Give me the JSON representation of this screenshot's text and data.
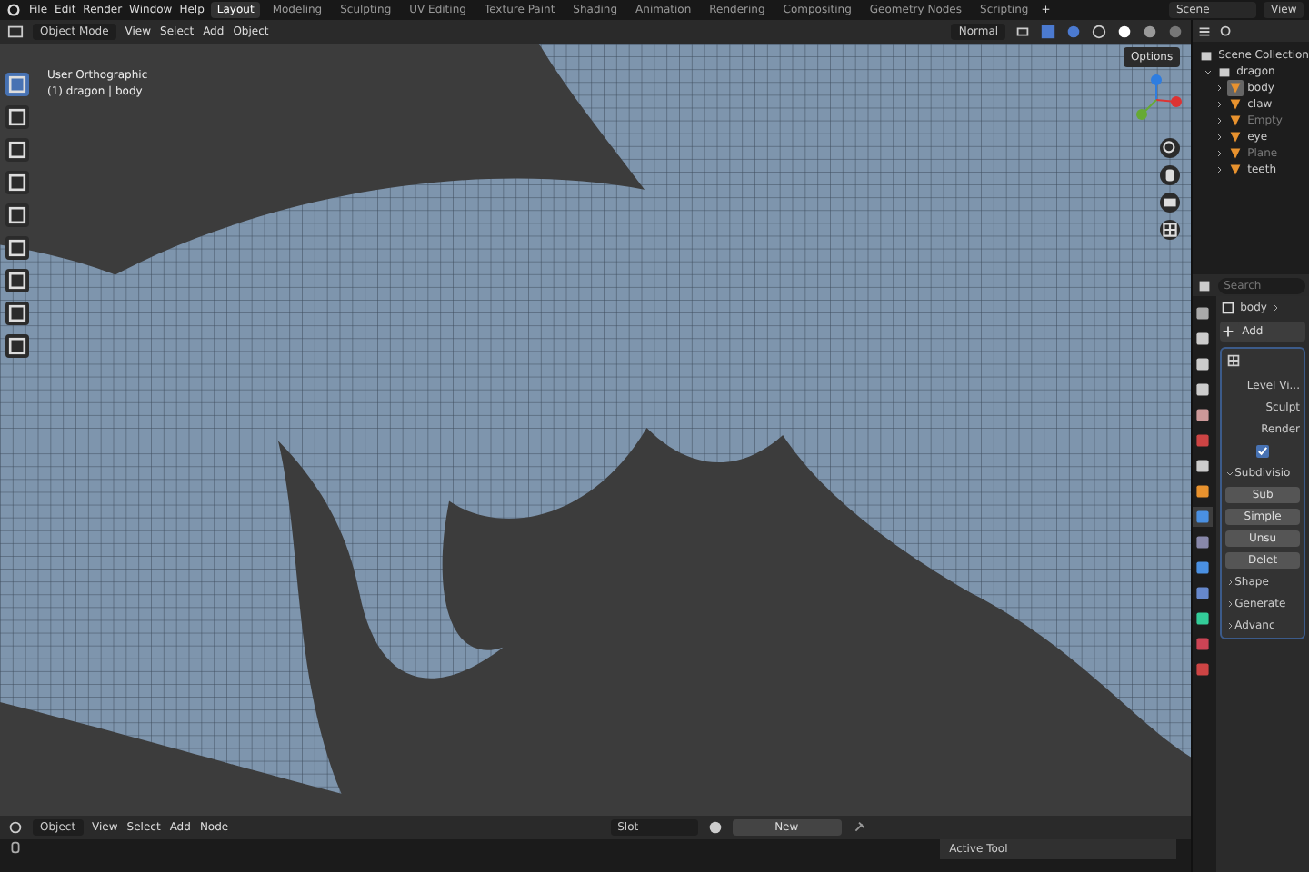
{
  "menu": [
    "File",
    "Edit",
    "Render",
    "Window",
    "Help"
  ],
  "workspaces": [
    {
      "label": "Layout",
      "selected": true
    },
    {
      "label": "Modeling",
      "selected": false
    },
    {
      "label": "Sculpting",
      "selected": false
    },
    {
      "label": "UV Editing",
      "selected": false
    },
    {
      "label": "Texture Paint",
      "selected": false
    },
    {
      "label": "Shading",
      "selected": false
    },
    {
      "label": "Animation",
      "selected": false
    },
    {
      "label": "Rendering",
      "selected": false
    },
    {
      "label": "Compositing",
      "selected": false
    },
    {
      "label": "Geometry Nodes",
      "selected": false
    },
    {
      "label": "Scripting",
      "selected": false
    }
  ],
  "add_workspace": "+",
  "scene": "Scene",
  "view_layer": "View",
  "viewport_header": {
    "mode": "Object Mode",
    "menus": [
      "View",
      "Select",
      "Add",
      "Object"
    ],
    "orientation": "Normal",
    "options": "Options"
  },
  "viewport": {
    "view_name": "User Orthographic",
    "object_info": "(1) dragon | body"
  },
  "outliner": {
    "root": "Scene Collection",
    "collection": {
      "label": "dragon",
      "expanded": true,
      "children": [
        {
          "label": "body",
          "selected": true,
          "disabled": false
        },
        {
          "label": "claw",
          "selected": false,
          "disabled": false
        },
        {
          "label": "Empty",
          "selected": false,
          "disabled": true
        },
        {
          "label": "eye",
          "selected": false,
          "disabled": false
        },
        {
          "label": "Plane",
          "selected": false,
          "disabled": true
        },
        {
          "label": "teeth",
          "selected": false,
          "disabled": false
        }
      ]
    }
  },
  "properties": {
    "search_placeholder": "Search",
    "breadcrumb": "body",
    "add_button": "Add",
    "items": [
      {
        "kind": "field",
        "label": "Level Vi..."
      },
      {
        "kind": "field",
        "label": "Sculpt"
      },
      {
        "kind": "field",
        "label": "Render"
      },
      {
        "kind": "checkbox",
        "checked": true
      },
      {
        "kind": "section",
        "label": "Subdivisio",
        "expanded": true
      },
      {
        "kind": "button",
        "label": "Sub"
      },
      {
        "kind": "button",
        "label": "Simple"
      },
      {
        "kind": "button",
        "label": "Unsu"
      },
      {
        "kind": "button",
        "label": "Delet"
      },
      {
        "kind": "section",
        "label": "Shape",
        "expanded": false
      },
      {
        "kind": "section",
        "label": "Generate",
        "expanded": false
      },
      {
        "kind": "section",
        "label": "Advanc",
        "expanded": false
      }
    ]
  },
  "node_header": {
    "mode": "Object",
    "menus": [
      "View",
      "Select",
      "Add",
      "Node"
    ],
    "slot": "Slot",
    "new_button": "New"
  },
  "status": {
    "panel": "Active Tool"
  }
}
